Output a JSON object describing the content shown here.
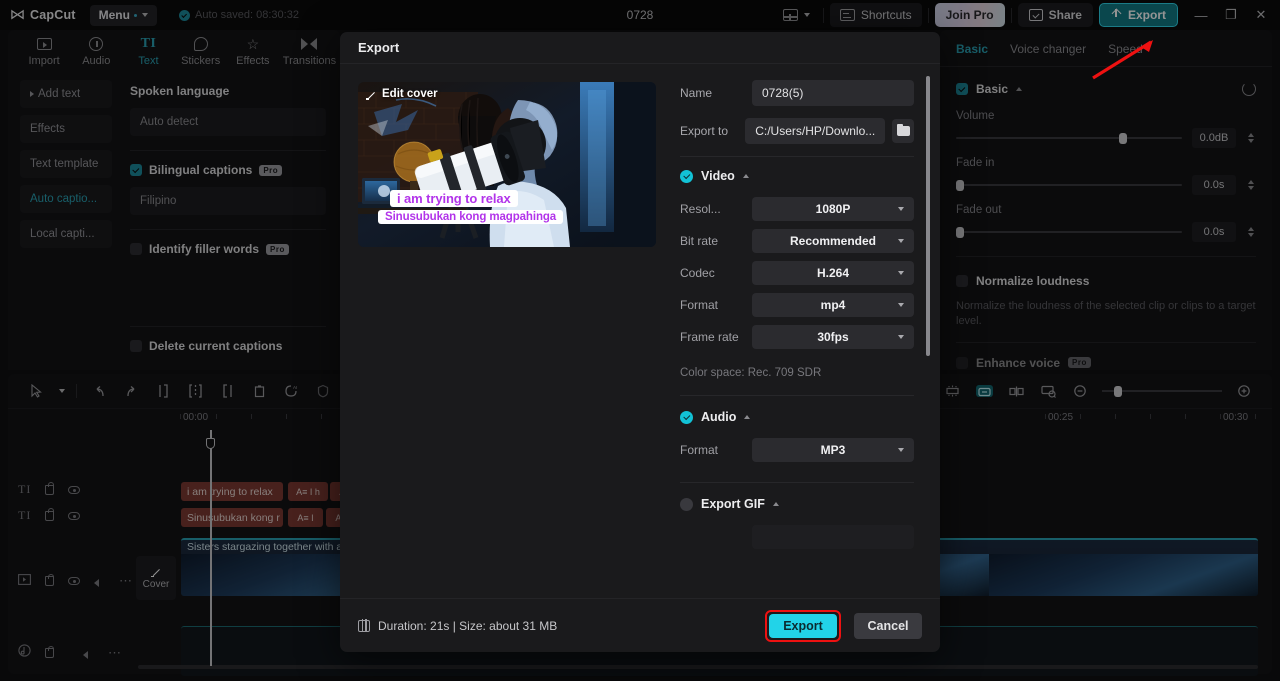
{
  "titlebar": {
    "app_name": "CapCut",
    "menu_label": "Menu",
    "autosave_text": "Auto saved: 08:30:32",
    "project_title": "0728",
    "shortcuts_label": "Shortcuts",
    "join_pro_label": "Join Pro",
    "share_label": "Share",
    "export_label": "Export",
    "minimize": "—",
    "maximize": "❐",
    "close": "✕",
    "accent": "#2aa3b5"
  },
  "tabs": [
    {
      "label": "Import",
      "icon": "import-icon",
      "active": false
    },
    {
      "label": "Audio",
      "icon": "audio-icon",
      "active": false
    },
    {
      "label": "Text",
      "icon": "text-icon",
      "active": true
    },
    {
      "label": "Stickers",
      "icon": "stickers-icon",
      "active": false
    },
    {
      "label": "Effects",
      "icon": "effects-icon",
      "active": false
    },
    {
      "label": "Transitions",
      "icon": "transitions-icon",
      "active": false
    }
  ],
  "subnav": [
    {
      "label": "Add text",
      "active": false,
      "caret": true
    },
    {
      "label": "Effects",
      "active": false,
      "caret": false
    },
    {
      "label": "Text template",
      "active": false,
      "caret": false
    },
    {
      "label": "Auto captio...",
      "active": true,
      "caret": false
    },
    {
      "label": "Local capti...",
      "active": false,
      "caret": false
    }
  ],
  "captions_panel": {
    "spoken_language_label": "Spoken language",
    "spoken_language_value": "Auto detect",
    "bilingual_label": "Bilingual captions",
    "bilingual_badge": "Pro",
    "bilingual_checked": true,
    "bilingual_value": "Filipino",
    "filler_label": "Identify filler words",
    "filler_badge": "Pro",
    "delete_label": "Delete current captions"
  },
  "right_panel": {
    "tabs": [
      {
        "label": "Basic",
        "active": true
      },
      {
        "label": "Voice changer",
        "active": false
      },
      {
        "label": "Speed",
        "active": false
      }
    ],
    "section_title": "Basic",
    "controls": [
      {
        "label": "Volume",
        "value": "0.0dB",
        "knob_pct": 72
      },
      {
        "label": "Fade in",
        "value": "0.0s",
        "knob_pct": 0
      },
      {
        "label": "Fade out",
        "value": "0.0s",
        "knob_pct": 0
      }
    ],
    "normalize_label": "Normalize loudness",
    "normalize_desc": "Normalize the loudness of the selected clip or clips to a target level.",
    "enhance_label": "Enhance voice",
    "enhance_badge": "Pro"
  },
  "timeline": {
    "toolbar_icons": [
      "select-arrow-icon",
      "chevron-down-icon",
      "undo-icon",
      "redo-icon",
      "split-left-icon",
      "split-icon",
      "split-right-icon",
      "delete-icon",
      "ai-mask-icon",
      "shield-icon"
    ],
    "right_icons": [
      "link-in-icon",
      "auto-fit-icon",
      "link-out-icon",
      "mirror-icon",
      "keyframe-icon",
      "zoom-out-icon",
      "zoom-in-icon"
    ],
    "ruler_labels": [
      "00:00",
      "00:25",
      "00:30"
    ],
    "cover_label": "Cover",
    "tracks": [
      {
        "type": "text",
        "icon": "text-track-icon",
        "clips": [
          "i am trying to relax",
          "A≡ I h",
          "A≡"
        ]
      },
      {
        "type": "text",
        "icon": "text-track-icon",
        "clips": [
          "Sinusubukan kong r",
          "A≡ I",
          "A≡"
        ]
      },
      {
        "type": "video",
        "icon": "video-track-icon",
        "clips": [
          "Sisters stargazing together with a"
        ]
      },
      {
        "type": "audio",
        "icon": "audio-track-icon",
        "clips": []
      }
    ]
  },
  "export_dialog": {
    "title": "Export",
    "edit_cover_label": "Edit cover",
    "preview_caption_line1": "i am trying to relax",
    "preview_caption_line2": "Sinusubukan kong magpahinga",
    "caption_color": "#b233ea",
    "name_label": "Name",
    "name_value": "0728(5)",
    "export_to_label": "Export to",
    "export_to_value": "C:/Users/HP/Downlo...",
    "video_section": {
      "title": "Video",
      "checked": true,
      "options": [
        {
          "label": "Resol...",
          "value": "1080P"
        },
        {
          "label": "Bit rate",
          "value": "Recommended"
        },
        {
          "label": "Codec",
          "value": "H.264"
        },
        {
          "label": "Format",
          "value": "mp4"
        },
        {
          "label": "Frame rate",
          "value": "30fps"
        }
      ],
      "color_space": "Color space: Rec. 709 SDR"
    },
    "audio_section": {
      "title": "Audio",
      "checked": true,
      "options": [
        {
          "label": "Format",
          "value": "MP3"
        }
      ]
    },
    "gif_section": {
      "title": "Export GIF",
      "checked": false
    },
    "footer_info": "Duration: 21s | Size: about 31 MB",
    "export_button": "Export",
    "cancel_button": "Cancel",
    "export_button_color": "#22d3e8",
    "highlight_color": "#ee1111"
  }
}
